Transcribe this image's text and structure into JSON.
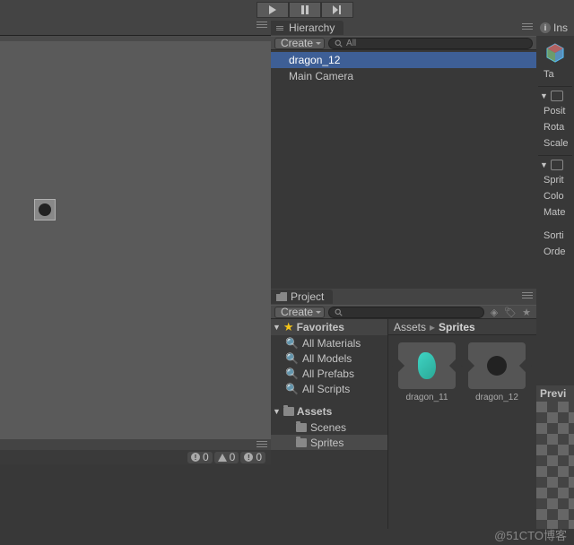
{
  "toolbar": {
    "play": "play",
    "pause": "pause",
    "step": "step"
  },
  "hierarchy": {
    "title": "Hierarchy",
    "create_label": "Create",
    "search_placeholder": "All",
    "items": [
      {
        "label": "dragon_12",
        "selected": true
      },
      {
        "label": "Main Camera",
        "selected": false
      }
    ]
  },
  "project": {
    "title": "Project",
    "create_label": "Create",
    "search_placeholder": "",
    "favorites_label": "Favorites",
    "favorites": [
      "All Materials",
      "All Models",
      "All Prefabs",
      "All Scripts"
    ],
    "assets_label": "Assets",
    "folders": [
      "Scenes",
      "Sprites"
    ],
    "breadcrumb": {
      "root": "Assets",
      "current": "Sprites"
    },
    "grid_items": [
      {
        "name": "dragon_11",
        "kind": "cyan-sprite"
      },
      {
        "name": "dragon_12",
        "kind": "black-circle"
      }
    ]
  },
  "inspector": {
    "title": "Ins",
    "tag_label": "Ta",
    "transform": {
      "position": "Posit",
      "rotation": "Rota",
      "scale": "Scale"
    },
    "sprite_renderer": {
      "sprite": "Sprit",
      "color": "Colo",
      "material": "Mate",
      "sorting": "Sorti",
      "order": "Orde"
    }
  },
  "preview": {
    "title": "Previ"
  },
  "console": {
    "info_count": "0",
    "warn_count": "0",
    "error_count": "0"
  },
  "watermark": "@51CTO博客"
}
